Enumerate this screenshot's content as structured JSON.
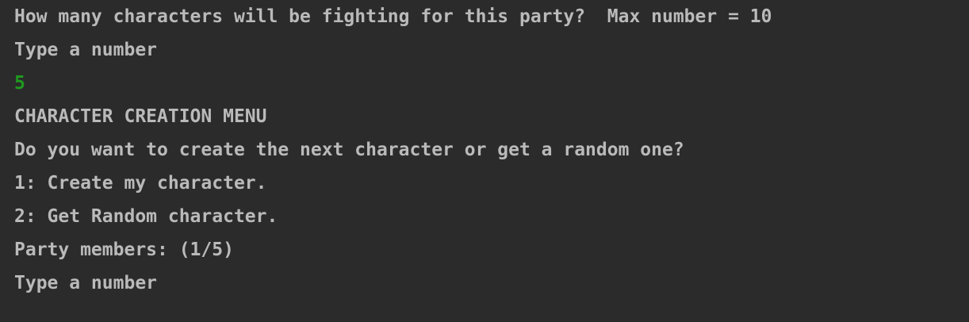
{
  "console": {
    "lines": [
      {
        "text": "How many characters will be fighting for this party?  Max number = 10",
        "kind": "output"
      },
      {
        "text": "Type a number",
        "kind": "output"
      },
      {
        "text": "5",
        "kind": "user-input"
      },
      {
        "text": "CHARACTER CREATION MENU",
        "kind": "output"
      },
      {
        "text": "Do you want to create the next character or get a random one?",
        "kind": "output"
      },
      {
        "text": "1: Create my character.",
        "kind": "output"
      },
      {
        "text": "2: Get Random character.",
        "kind": "output"
      },
      {
        "text": "Party members: (1/5)",
        "kind": "output"
      },
      {
        "text": "Type a number",
        "kind": "output"
      }
    ],
    "colors": {
      "background": "#2b2b2b",
      "output_text": "#bababa",
      "user_input_text": "#1f9a1f"
    }
  }
}
